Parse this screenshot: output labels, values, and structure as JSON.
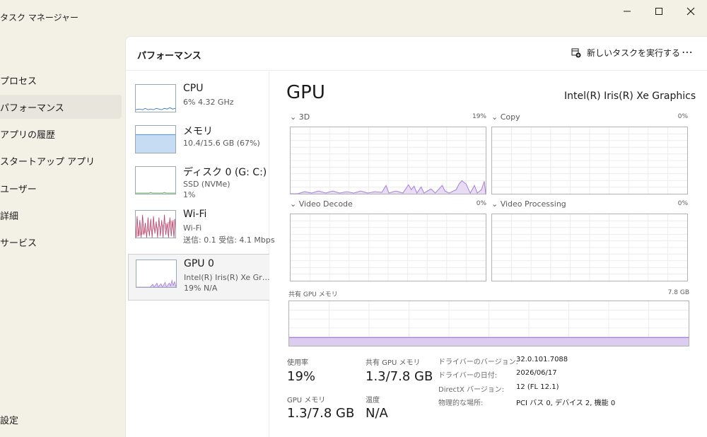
{
  "window": {
    "title": "タスク マネージャー"
  },
  "nav": {
    "items": [
      "プロセス",
      "パフォーマンス",
      "アプリの履歴",
      "スタートアップ アプリ",
      "ユーザー",
      "詳細",
      "サービス"
    ],
    "settings": "設定"
  },
  "header": {
    "title": "パフォーマンス",
    "new_task": "新しいタスクを実行する"
  },
  "devices": [
    {
      "name": "CPU",
      "line1": "6%  4.32 GHz",
      "line2": ""
    },
    {
      "name": "メモリ",
      "line1": "10.4/15.6 GB (67%)",
      "line2": ""
    },
    {
      "name": "ディスク 0 (G: C:)",
      "line1": "SSD (NVMe)",
      "line2": "1%"
    },
    {
      "name": "Wi-Fi",
      "line1": "Wi-Fi",
      "line2": "送信: 0.1  受信: 4.1 Mbps"
    },
    {
      "name": "GPU 0",
      "line1": "Intel(R) Iris(R) Xe Graphics",
      "line2": "19%  N/A"
    }
  ],
  "gpu": {
    "title": "GPU",
    "model": "Intel(R) Iris(R) Xe Graphics",
    "engines": [
      {
        "label": "3D",
        "percent": "19%"
      },
      {
        "label": "Copy",
        "percent": "0%"
      },
      {
        "label": "Video Decode",
        "percent": "0%"
      },
      {
        "label": "Video Processing",
        "percent": "0%"
      }
    ],
    "shared_memory": {
      "label": "共有 GPU メモリ",
      "max": "7.8 GB"
    },
    "stats": {
      "usage_label": "使用率",
      "usage_value": "19%",
      "shared_label": "共有 GPU メモリ",
      "shared_value": "1.3/7.8 GB",
      "gpu_mem_label": "GPU メモリ",
      "gpu_mem_value": "1.3/7.8 GB",
      "temp_label": "温度",
      "temp_value": "N/A"
    },
    "info": [
      {
        "label": "ドライバーのバージョン:",
        "value": "32.0.101.7088"
      },
      {
        "label": "ドライバーの日付:",
        "value": "2026/06/17"
      },
      {
        "label": "DirectX バージョン:",
        "value": "12 (FL 12.1)"
      },
      {
        "label": "物理的な場所:",
        "value": "PCI バス 0, デバイス 2, 機能 0"
      }
    ]
  },
  "colors": {
    "gpu": "#a67ed6",
    "gpu_fill": "#dccdf0",
    "memory": "#4f8fd1",
    "memory_fill": "#c6dcf2",
    "wifi": "#b5426b",
    "cpu": "#3a7bc8"
  }
}
